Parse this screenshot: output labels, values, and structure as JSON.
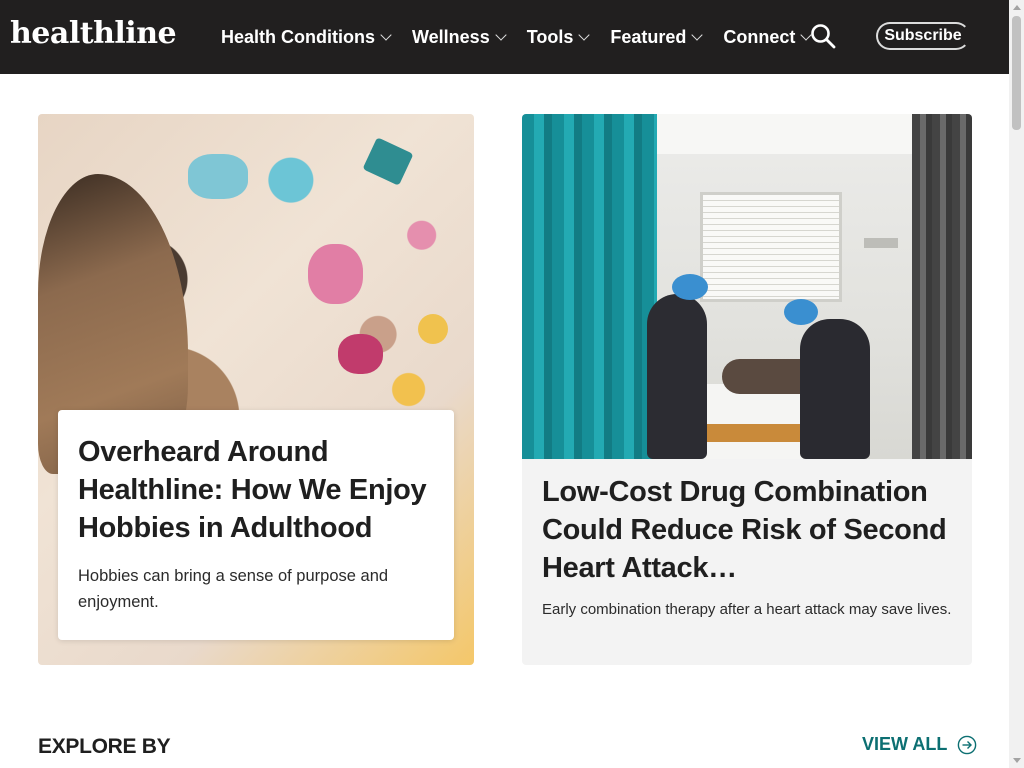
{
  "header": {
    "logo": "healthline",
    "nav": [
      {
        "label": "Health Conditions"
      },
      {
        "label": "Wellness"
      },
      {
        "label": "Tools"
      },
      {
        "label": "Featured"
      },
      {
        "label": "Connect"
      }
    ],
    "search_icon": "search-icon",
    "subscribe_label": "Subscribe"
  },
  "cards": [
    {
      "title": "Overheard Around Healthline: How We Enjoy Hobbies in Adulthood",
      "description": "Hobbies can bring a sense of purpose and enjoyment."
    },
    {
      "title": "Low-Cost Drug Combination Could Reduce Risk of Second Heart Attack…",
      "description": "Early combination therapy after a heart attack may save lives."
    }
  ],
  "explore": {
    "heading": "EXPLORE BY",
    "view_all": "VIEW ALL",
    "view_all_icon": "arrow-circle-right-icon"
  },
  "colors": {
    "header_bg": "#211f1f",
    "accent_teal": "#0c6f72"
  }
}
